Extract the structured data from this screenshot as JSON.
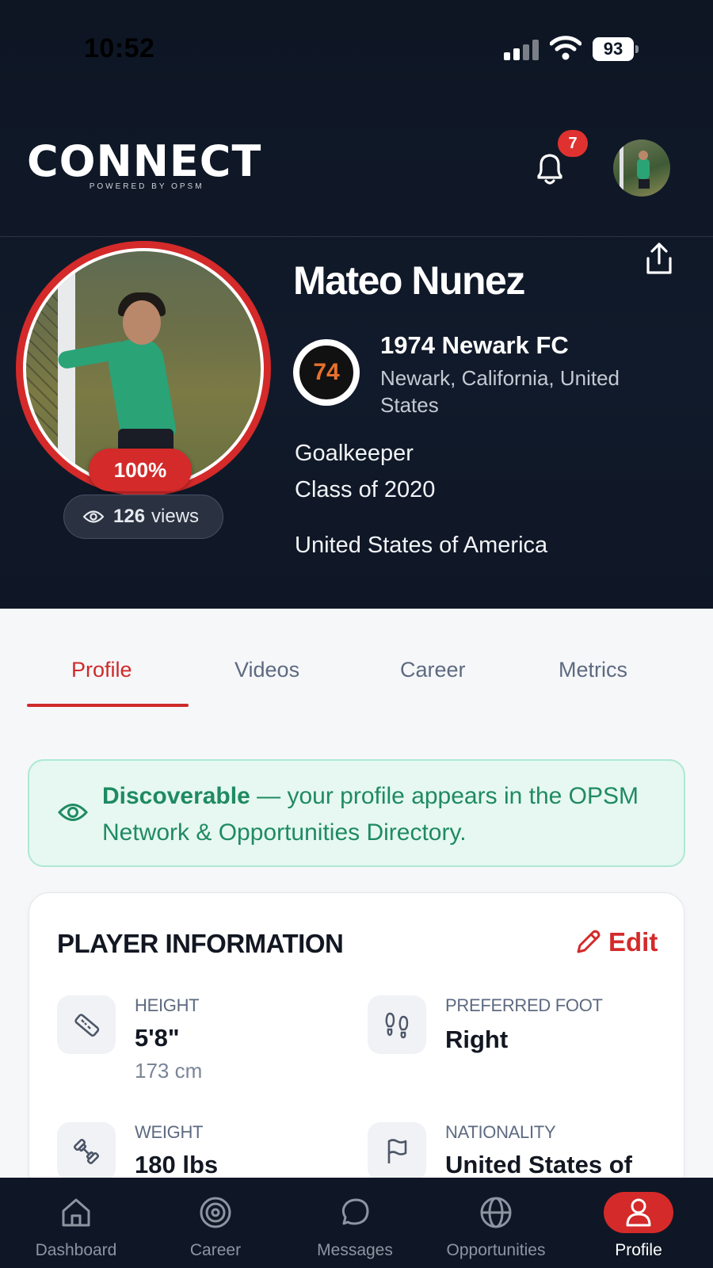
{
  "status_bar": {
    "time": "10:52",
    "battery": "93"
  },
  "header": {
    "logo_text": "CONNECT",
    "logo_subtitle": "POWERED BY OPSM",
    "notifications_count": "7"
  },
  "player": {
    "name": "Mateo Nunez",
    "profile_completion": "100%",
    "views_count": "126",
    "views_label": "views",
    "club_name": "1974 Newark FC",
    "club_badge_text": "74",
    "club_location": "Newark, California, United States",
    "position": "Goalkeeper",
    "class_of": "Class of 2020",
    "country": "United States of America"
  },
  "tabs": [
    {
      "label": "Profile",
      "active": true
    },
    {
      "label": "Videos",
      "active": false
    },
    {
      "label": "Career",
      "active": false
    },
    {
      "label": "Metrics",
      "active": false
    }
  ],
  "discoverable": {
    "title": "Discoverable",
    "message": " — your profile appears in the OPSM Network & Opportunities Directory."
  },
  "player_info": {
    "title": "PLAYER INFORMATION",
    "edit_label": "Edit",
    "fields": [
      {
        "label": "HEIGHT",
        "value": "5'8\"",
        "sub": "173 cm",
        "icon": "ruler-icon"
      },
      {
        "label": "PREFERRED FOOT",
        "value": "Right",
        "icon": "footprints-icon"
      },
      {
        "label": "WEIGHT",
        "value": "180 lbs",
        "icon": "dumbbell-icon"
      },
      {
        "label": "NATIONALITY",
        "value": "United States of",
        "icon": "flag-icon"
      }
    ]
  },
  "bottom_nav": [
    {
      "label": "Dashboard",
      "icon": "home-icon",
      "active": false
    },
    {
      "label": "Career",
      "icon": "target-icon",
      "active": false
    },
    {
      "label": "Messages",
      "icon": "chat-icon",
      "active": false
    },
    {
      "label": "Opportunities",
      "icon": "globe-icon",
      "active": false
    },
    {
      "label": "Profile",
      "icon": "user-icon",
      "active": true
    }
  ],
  "colors": {
    "accent": "#d42a2a",
    "dark_bg": "#0e1624",
    "discover_green": "#1f8a63"
  }
}
